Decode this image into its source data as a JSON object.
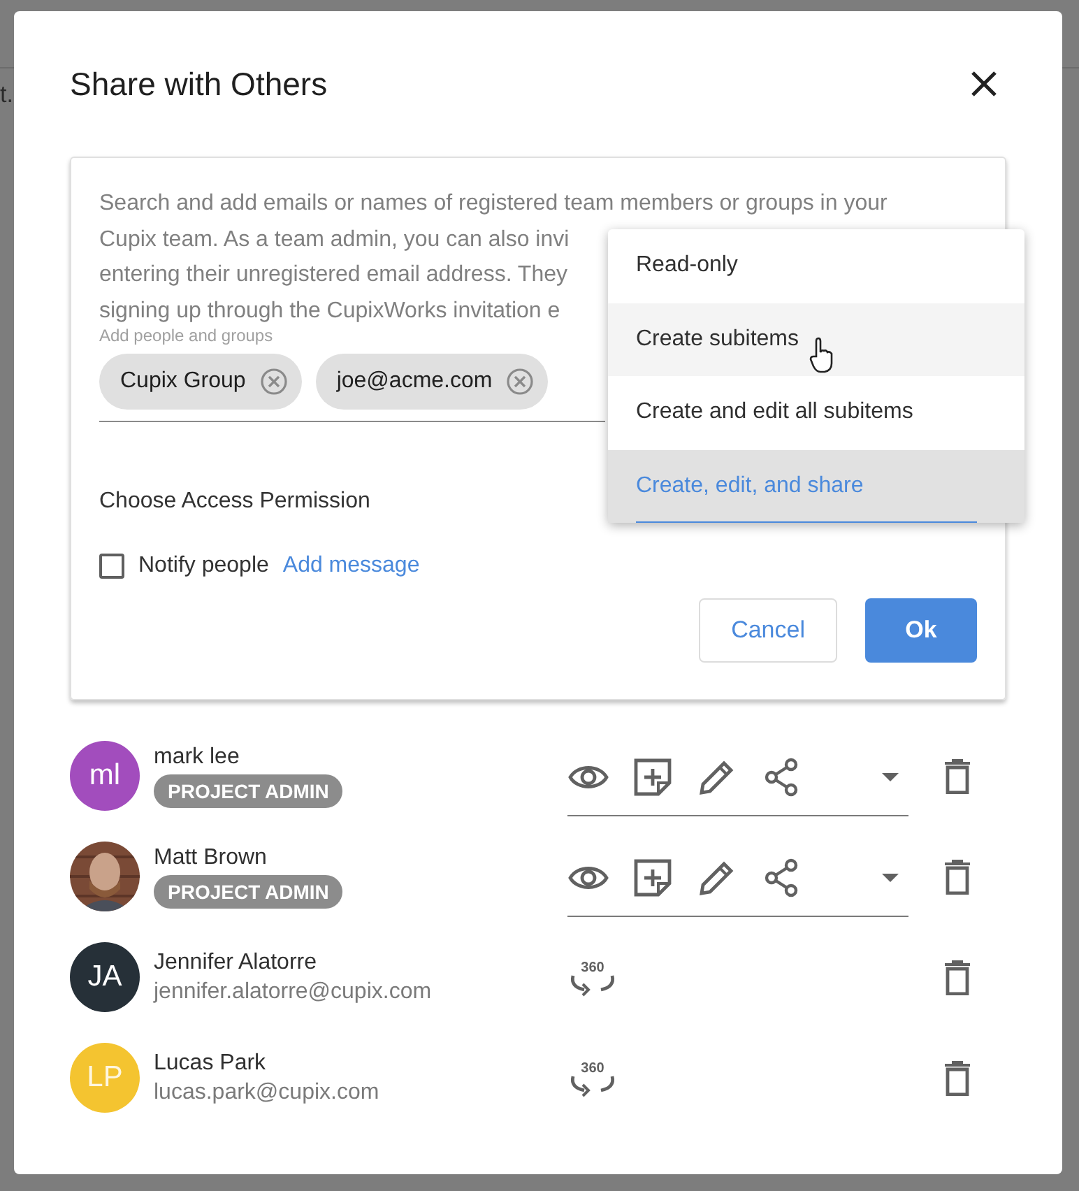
{
  "backdrop": {
    "fragments": [
      "t."
    ]
  },
  "dialog": {
    "title": "Share with Others"
  },
  "invite": {
    "help_lines": [
      "Search and add emails or names of registered team members or groups in your",
      "Cupix team. As a team admin, you can also invi",
      "entering their unregistered email address. They",
      "signing up through the CupixWorks invitation e"
    ],
    "field_label": "Add people and groups",
    "chips": [
      "Cupix Group",
      "joe@acme.com"
    ],
    "permission_label": "Choose Access Permission",
    "notify": {
      "label": "Notify people",
      "checked": false
    },
    "add_message": "Add message",
    "buttons": [
      {
        "label": "Cancel",
        "kind": "secondary"
      },
      {
        "label": "Ok",
        "kind": "primary"
      }
    ]
  },
  "permission_menu": {
    "items": [
      {
        "label": "Read-only",
        "hovered": false,
        "selected": false
      },
      {
        "label": "Create subitems",
        "hovered": true,
        "selected": false
      },
      {
        "label": "Create and edit all subitems",
        "hovered": false,
        "selected": false
      },
      {
        "label": "Create, edit, and share",
        "hovered": false,
        "selected": true
      }
    ]
  },
  "members": [
    {
      "kind": "admin",
      "name": "mark lee",
      "initials": "ml",
      "color": "#a24dbd",
      "role": "PROJECT ADMIN"
    },
    {
      "kind": "admin",
      "name": "Matt Brown",
      "role": "PROJECT ADMIN"
    },
    {
      "kind": "user",
      "name": "Jennifer Alatorre",
      "initials": "JA",
      "color": "#263038",
      "email": "jennifer.alatorre@cupix.com",
      "badge": "360"
    },
    {
      "kind": "user",
      "name": "Lucas Park",
      "initials": "LP",
      "color": "#f4c430",
      "email": "lucas.park@cupix.com",
      "badge": "360"
    }
  ]
}
